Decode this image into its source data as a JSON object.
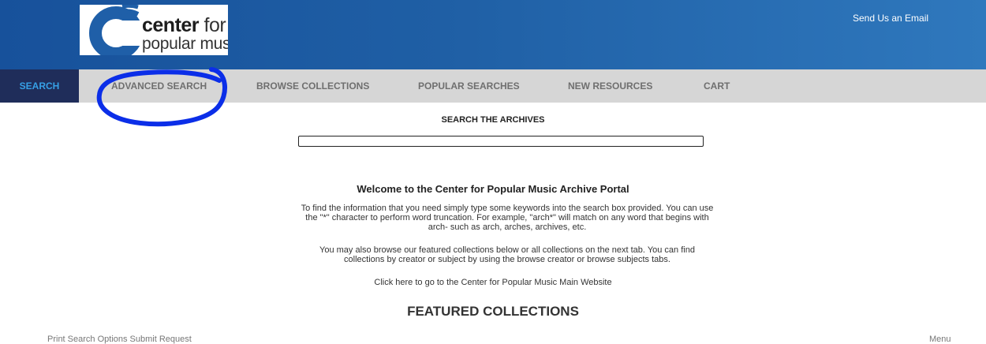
{
  "header": {
    "logo": {
      "word1": "center",
      "word2": "for",
      "line2": "popular music"
    },
    "email_link": "Send Us an Email"
  },
  "nav": {
    "tabs": [
      {
        "label": "SEARCH",
        "active": true
      },
      {
        "label": "ADVANCED SEARCH"
      },
      {
        "label": "BROWSE COLLECTIONS"
      },
      {
        "label": "POPULAR SEARCHES"
      },
      {
        "label": "NEW RESOURCES"
      },
      {
        "label": "CART"
      }
    ]
  },
  "search": {
    "title": "SEARCH THE ARCHIVES",
    "value": ""
  },
  "welcome": {
    "title": "Welcome to the Center for Popular Music Archive Portal",
    "para1": "To find the information that you need simply type some keywords into the search box provided. You can use the \"*\" character to perform word truncation. For example, \"arch*\" will match on any word that begins with arch- such as arch, arches, archives, etc.",
    "para2": "You may also browse our featured collections below or all collections on the next tab. You can find collections by creator or subject by using the browse creator or browse subjects tabs.",
    "main_link": "Click here to go to the Center for Popular Music Main Website"
  },
  "featured": {
    "title": "FEATURED COLLECTIONS"
  },
  "bottom_bar": {
    "left": "Print   Search Options   Submit Request",
    "right": "Menu"
  },
  "colors": {
    "header_start": "#17519b",
    "header_end": "#2f78bd",
    "nav_bg": "#d6d6d6",
    "active_tab_bg": "#1f2d5a",
    "active_tab_text": "#36a0e6",
    "annotation": "#0b2ee8"
  }
}
